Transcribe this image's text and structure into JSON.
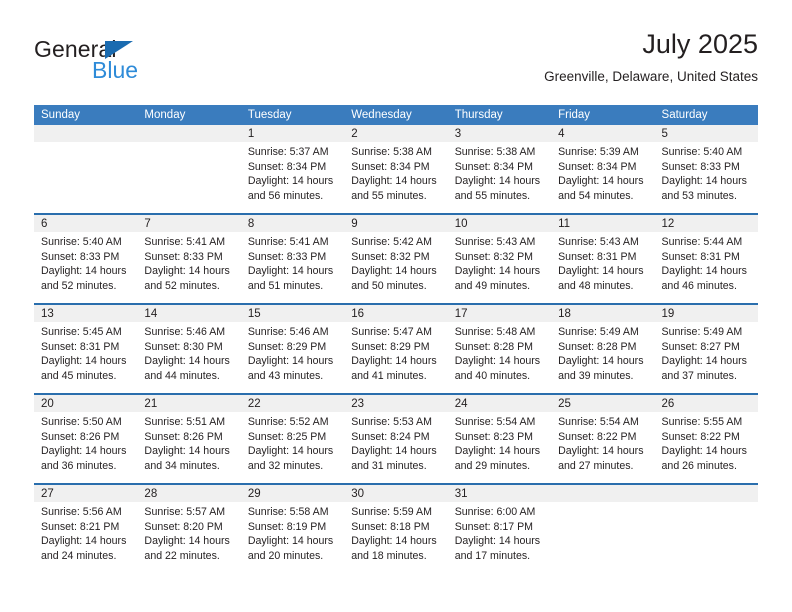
{
  "brand": {
    "name_part1": "General",
    "name_part2": "Blue",
    "triangle_color": "#1a6bb0",
    "blue_text_color": "#2e8bd8"
  },
  "header": {
    "month_title": "July 2025",
    "location": "Greenville, Delaware, United States"
  },
  "theme": {
    "header_bg": "#3a7cbe",
    "row_divider": "#2a6ead",
    "daynum_band_bg": "#f0f0f0",
    "text_color": "#231f20"
  },
  "calendar": {
    "weekday_headers": [
      "Sunday",
      "Monday",
      "Tuesday",
      "Wednesday",
      "Thursday",
      "Friday",
      "Saturday"
    ],
    "labels": {
      "sunrise_prefix": "Sunrise:",
      "sunset_prefix": "Sunset:",
      "daylight_prefix": "Daylight:"
    },
    "weeks": [
      [
        {
          "day": ""
        },
        {
          "day": ""
        },
        {
          "day": "1",
          "sunrise": "Sunrise: 5:37 AM",
          "sunset": "Sunset: 8:34 PM",
          "daylight_line1": "Daylight: 14 hours",
          "daylight_line2": "and 56 minutes."
        },
        {
          "day": "2",
          "sunrise": "Sunrise: 5:38 AM",
          "sunset": "Sunset: 8:34 PM",
          "daylight_line1": "Daylight: 14 hours",
          "daylight_line2": "and 55 minutes."
        },
        {
          "day": "3",
          "sunrise": "Sunrise: 5:38 AM",
          "sunset": "Sunset: 8:34 PM",
          "daylight_line1": "Daylight: 14 hours",
          "daylight_line2": "and 55 minutes."
        },
        {
          "day": "4",
          "sunrise": "Sunrise: 5:39 AM",
          "sunset": "Sunset: 8:34 PM",
          "daylight_line1": "Daylight: 14 hours",
          "daylight_line2": "and 54 minutes."
        },
        {
          "day": "5",
          "sunrise": "Sunrise: 5:40 AM",
          "sunset": "Sunset: 8:33 PM",
          "daylight_line1": "Daylight: 14 hours",
          "daylight_line2": "and 53 minutes."
        }
      ],
      [
        {
          "day": "6",
          "sunrise": "Sunrise: 5:40 AM",
          "sunset": "Sunset: 8:33 PM",
          "daylight_line1": "Daylight: 14 hours",
          "daylight_line2": "and 52 minutes."
        },
        {
          "day": "7",
          "sunrise": "Sunrise: 5:41 AM",
          "sunset": "Sunset: 8:33 PM",
          "daylight_line1": "Daylight: 14 hours",
          "daylight_line2": "and 52 minutes."
        },
        {
          "day": "8",
          "sunrise": "Sunrise: 5:41 AM",
          "sunset": "Sunset: 8:33 PM",
          "daylight_line1": "Daylight: 14 hours",
          "daylight_line2": "and 51 minutes."
        },
        {
          "day": "9",
          "sunrise": "Sunrise: 5:42 AM",
          "sunset": "Sunset: 8:32 PM",
          "daylight_line1": "Daylight: 14 hours",
          "daylight_line2": "and 50 minutes."
        },
        {
          "day": "10",
          "sunrise": "Sunrise: 5:43 AM",
          "sunset": "Sunset: 8:32 PM",
          "daylight_line1": "Daylight: 14 hours",
          "daylight_line2": "and 49 minutes."
        },
        {
          "day": "11",
          "sunrise": "Sunrise: 5:43 AM",
          "sunset": "Sunset: 8:31 PM",
          "daylight_line1": "Daylight: 14 hours",
          "daylight_line2": "and 48 minutes."
        },
        {
          "day": "12",
          "sunrise": "Sunrise: 5:44 AM",
          "sunset": "Sunset: 8:31 PM",
          "daylight_line1": "Daylight: 14 hours",
          "daylight_line2": "and 46 minutes."
        }
      ],
      [
        {
          "day": "13",
          "sunrise": "Sunrise: 5:45 AM",
          "sunset": "Sunset: 8:31 PM",
          "daylight_line1": "Daylight: 14 hours",
          "daylight_line2": "and 45 minutes."
        },
        {
          "day": "14",
          "sunrise": "Sunrise: 5:46 AM",
          "sunset": "Sunset: 8:30 PM",
          "daylight_line1": "Daylight: 14 hours",
          "daylight_line2": "and 44 minutes."
        },
        {
          "day": "15",
          "sunrise": "Sunrise: 5:46 AM",
          "sunset": "Sunset: 8:29 PM",
          "daylight_line1": "Daylight: 14 hours",
          "daylight_line2": "and 43 minutes."
        },
        {
          "day": "16",
          "sunrise": "Sunrise: 5:47 AM",
          "sunset": "Sunset: 8:29 PM",
          "daylight_line1": "Daylight: 14 hours",
          "daylight_line2": "and 41 minutes."
        },
        {
          "day": "17",
          "sunrise": "Sunrise: 5:48 AM",
          "sunset": "Sunset: 8:28 PM",
          "daylight_line1": "Daylight: 14 hours",
          "daylight_line2": "and 40 minutes."
        },
        {
          "day": "18",
          "sunrise": "Sunrise: 5:49 AM",
          "sunset": "Sunset: 8:28 PM",
          "daylight_line1": "Daylight: 14 hours",
          "daylight_line2": "and 39 minutes."
        },
        {
          "day": "19",
          "sunrise": "Sunrise: 5:49 AM",
          "sunset": "Sunset: 8:27 PM",
          "daylight_line1": "Daylight: 14 hours",
          "daylight_line2": "and 37 minutes."
        }
      ],
      [
        {
          "day": "20",
          "sunrise": "Sunrise: 5:50 AM",
          "sunset": "Sunset: 8:26 PM",
          "daylight_line1": "Daylight: 14 hours",
          "daylight_line2": "and 36 minutes."
        },
        {
          "day": "21",
          "sunrise": "Sunrise: 5:51 AM",
          "sunset": "Sunset: 8:26 PM",
          "daylight_line1": "Daylight: 14 hours",
          "daylight_line2": "and 34 minutes."
        },
        {
          "day": "22",
          "sunrise": "Sunrise: 5:52 AM",
          "sunset": "Sunset: 8:25 PM",
          "daylight_line1": "Daylight: 14 hours",
          "daylight_line2": "and 32 minutes."
        },
        {
          "day": "23",
          "sunrise": "Sunrise: 5:53 AM",
          "sunset": "Sunset: 8:24 PM",
          "daylight_line1": "Daylight: 14 hours",
          "daylight_line2": "and 31 minutes."
        },
        {
          "day": "24",
          "sunrise": "Sunrise: 5:54 AM",
          "sunset": "Sunset: 8:23 PM",
          "daylight_line1": "Daylight: 14 hours",
          "daylight_line2": "and 29 minutes."
        },
        {
          "day": "25",
          "sunrise": "Sunrise: 5:54 AM",
          "sunset": "Sunset: 8:22 PM",
          "daylight_line1": "Daylight: 14 hours",
          "daylight_line2": "and 27 minutes."
        },
        {
          "day": "26",
          "sunrise": "Sunrise: 5:55 AM",
          "sunset": "Sunset: 8:22 PM",
          "daylight_line1": "Daylight: 14 hours",
          "daylight_line2": "and 26 minutes."
        }
      ],
      [
        {
          "day": "27",
          "sunrise": "Sunrise: 5:56 AM",
          "sunset": "Sunset: 8:21 PM",
          "daylight_line1": "Daylight: 14 hours",
          "daylight_line2": "and 24 minutes."
        },
        {
          "day": "28",
          "sunrise": "Sunrise: 5:57 AM",
          "sunset": "Sunset: 8:20 PM",
          "daylight_line1": "Daylight: 14 hours",
          "daylight_line2": "and 22 minutes."
        },
        {
          "day": "29",
          "sunrise": "Sunrise: 5:58 AM",
          "sunset": "Sunset: 8:19 PM",
          "daylight_line1": "Daylight: 14 hours",
          "daylight_line2": "and 20 minutes."
        },
        {
          "day": "30",
          "sunrise": "Sunrise: 5:59 AM",
          "sunset": "Sunset: 8:18 PM",
          "daylight_line1": "Daylight: 14 hours",
          "daylight_line2": "and 18 minutes."
        },
        {
          "day": "31",
          "sunrise": "Sunrise: 6:00 AM",
          "sunset": "Sunset: 8:17 PM",
          "daylight_line1": "Daylight: 14 hours",
          "daylight_line2": "and 17 minutes."
        },
        {
          "day": ""
        },
        {
          "day": ""
        }
      ]
    ]
  }
}
